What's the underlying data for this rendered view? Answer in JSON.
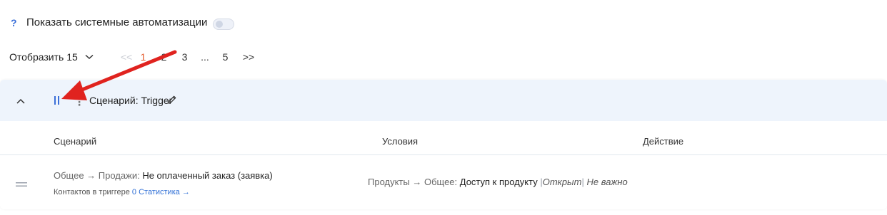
{
  "toolbar": {
    "help_label": "?",
    "toggle_label": "Показать системные автоматизации",
    "toggle_on": false
  },
  "pagination": {
    "per_page_label": "Отобразить 15",
    "first": "<<",
    "pages": [
      "1",
      "2",
      "3"
    ],
    "ellipsis": "...",
    "last_page": "5",
    "next": ">>",
    "current": "1"
  },
  "group": {
    "more_label": "⋮",
    "scenario_title": "Сценарий: Trigger"
  },
  "table": {
    "headers": [
      "Сценарий",
      "Условия",
      "Действие"
    ],
    "row": {
      "path_prefix": "Общее → Продажи: ",
      "path_name": "Не оплаченный заказ (заявка)",
      "contacts_label": "Контактов в триггере",
      "contacts_count": "0",
      "stats_link": "Статистика →",
      "cond_prefix": "Продукты → Общее: ",
      "cond_value": "Доступ к продукту",
      "cond_sep": "|",
      "cond_state": "Открыт",
      "cond_extra": "Не важно"
    }
  },
  "colors": {
    "accent": "#3b6fd8",
    "active_page": "#e55a2b",
    "annotation_arrow": "#e0231f",
    "header_bg": "#eef4fc"
  }
}
